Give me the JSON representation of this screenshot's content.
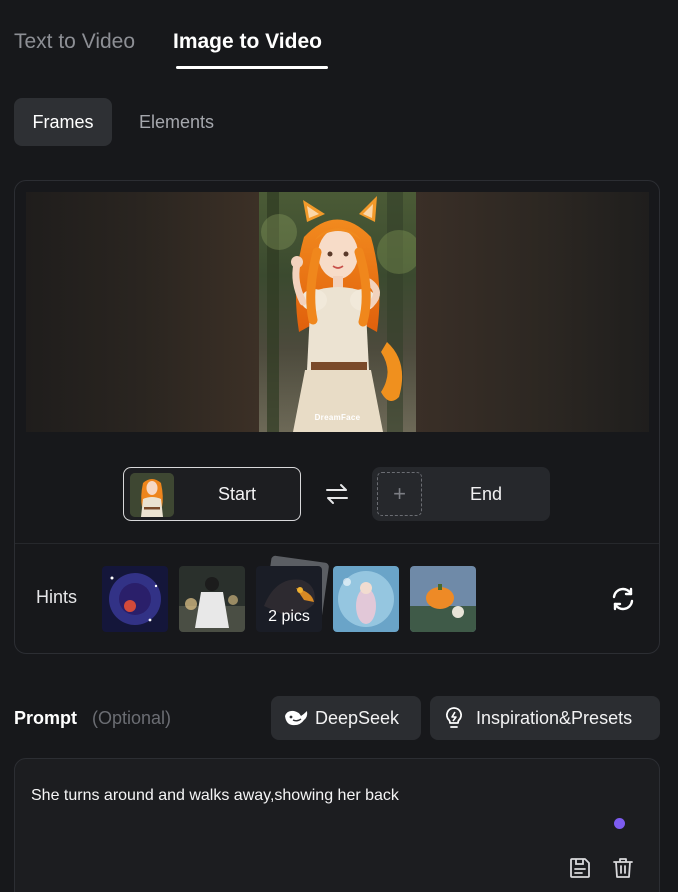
{
  "mode_tabs": {
    "text_to_video": "Text to Video",
    "image_to_video": "Image to Video"
  },
  "sub_tabs": {
    "frames": "Frames",
    "elements": "Elements"
  },
  "preview": {
    "watermark": "DreamFace"
  },
  "frames": {
    "start_label": "Start",
    "end_label": "End"
  },
  "hints": {
    "label": "Hints",
    "items": [
      {
        "badge": ""
      },
      {
        "badge": ""
      },
      {
        "badge": "2 pics"
      },
      {
        "badge": ""
      },
      {
        "badge": ""
      }
    ]
  },
  "prompt": {
    "label": "Prompt",
    "optional": "(Optional)",
    "deepseek_label": "DeepSeek",
    "inspiration_label": "Inspiration&Presets",
    "value": "She turns around and walks away,showing her back"
  },
  "colors": {
    "background": "#17181b",
    "accent_dot": "#7d5cf0"
  }
}
